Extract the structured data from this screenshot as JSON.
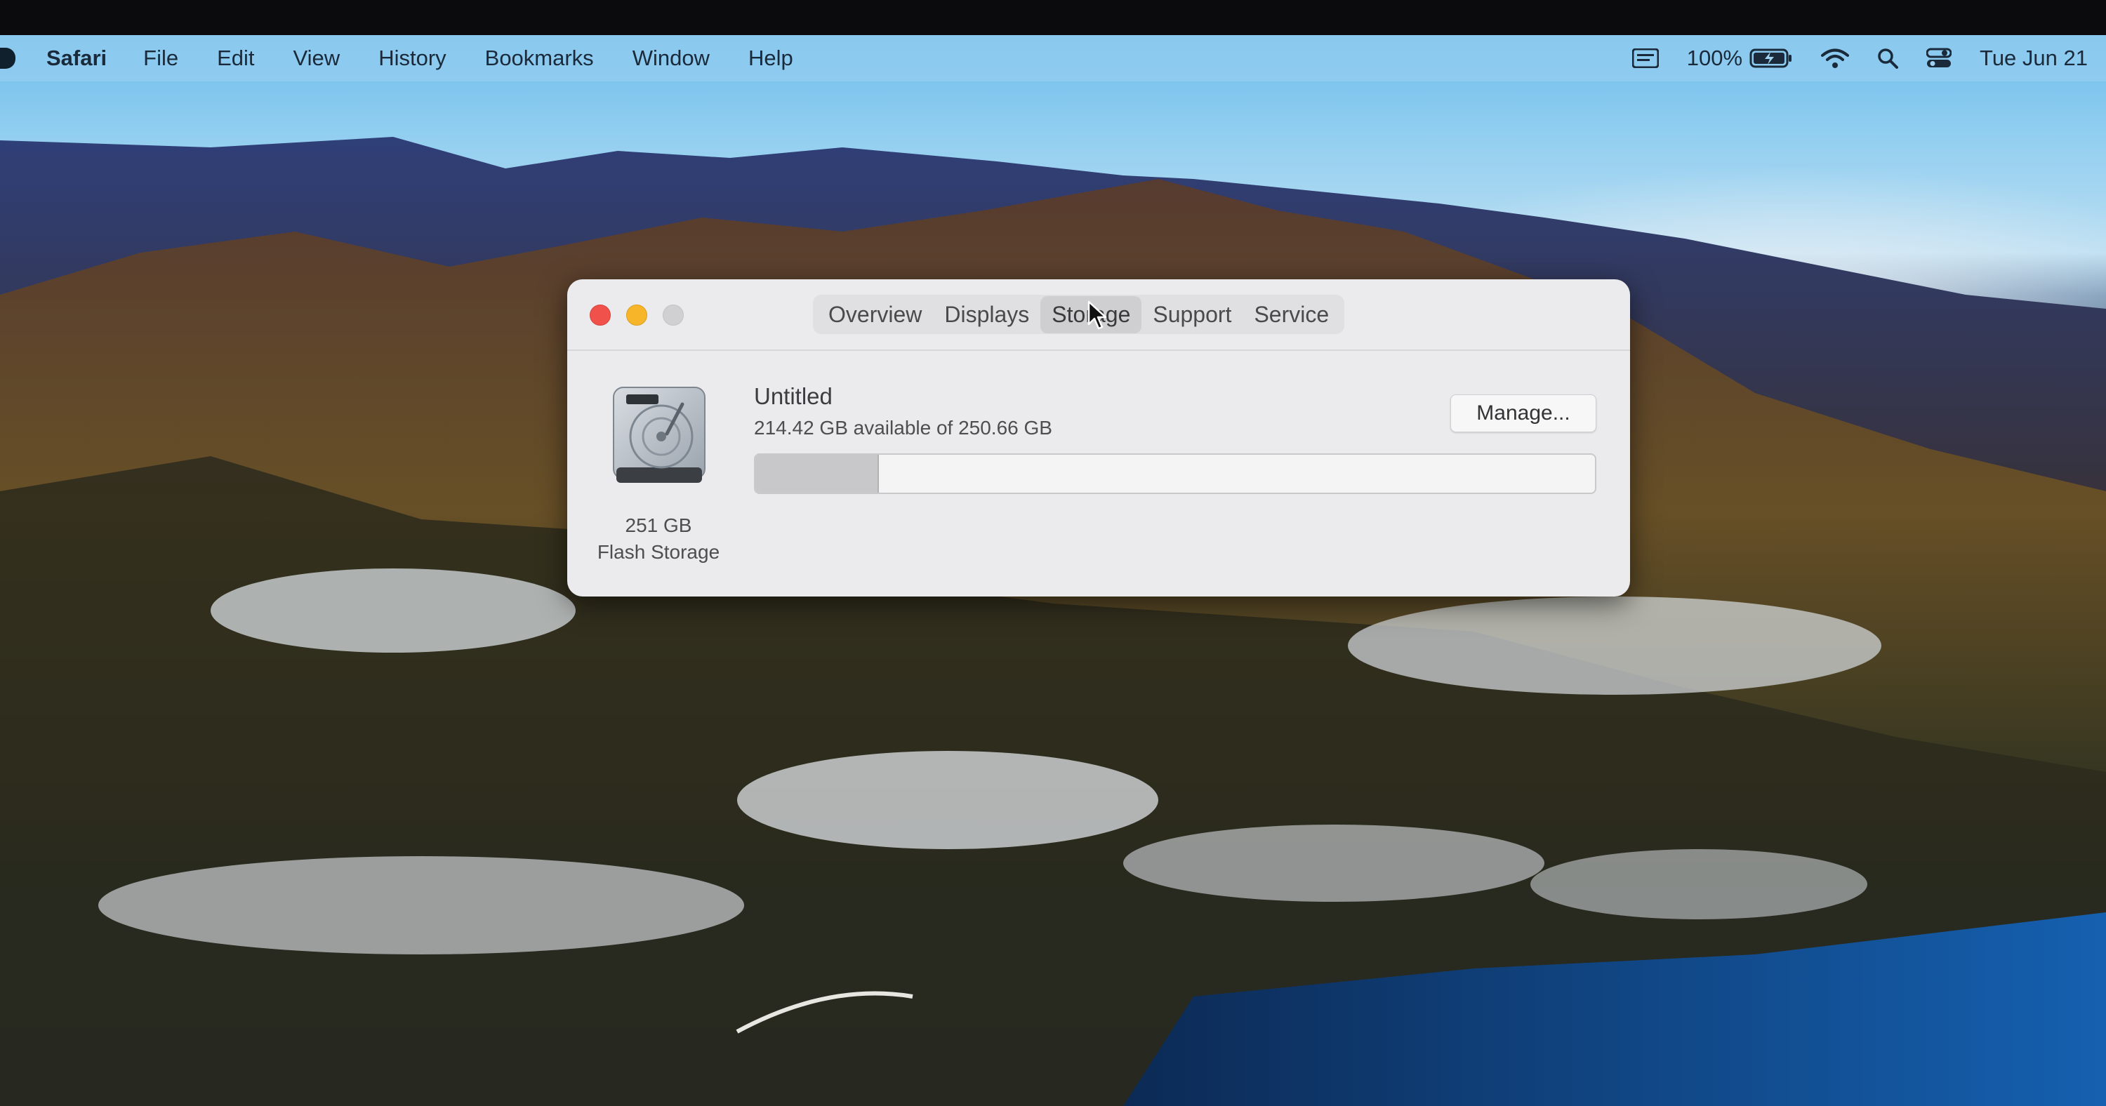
{
  "menubar": {
    "app_name": "Safari",
    "items": [
      "File",
      "Edit",
      "View",
      "History",
      "Bookmarks",
      "Window",
      "Help"
    ],
    "battery_percent": "100%",
    "datetime": "Tue Jun 21",
    "icons": [
      "apple-icon",
      "input-source-icon",
      "battery-charging-icon",
      "wifi-icon",
      "spotlight-search-icon",
      "control-center-icon"
    ]
  },
  "window": {
    "tabs": [
      {
        "label": "Overview",
        "active": false
      },
      {
        "label": "Displays",
        "active": false
      },
      {
        "label": "Storage",
        "active": true
      },
      {
        "label": "Support",
        "active": false
      },
      {
        "label": "Service",
        "active": false
      }
    ],
    "disk": {
      "capacity": "251 GB",
      "type": "Flash Storage",
      "icon": "hard-drive-icon"
    },
    "volume": {
      "name": "Untitled",
      "availability": "214.42 GB available of 250.66 GB",
      "used_fraction": 0.1456,
      "manage_label": "Manage..."
    }
  },
  "colors": {
    "close": "#f0514a",
    "minimize": "#f7b52a",
    "zoom_inactive": "#d0cfd1",
    "window_bg": "#ebeaec"
  }
}
